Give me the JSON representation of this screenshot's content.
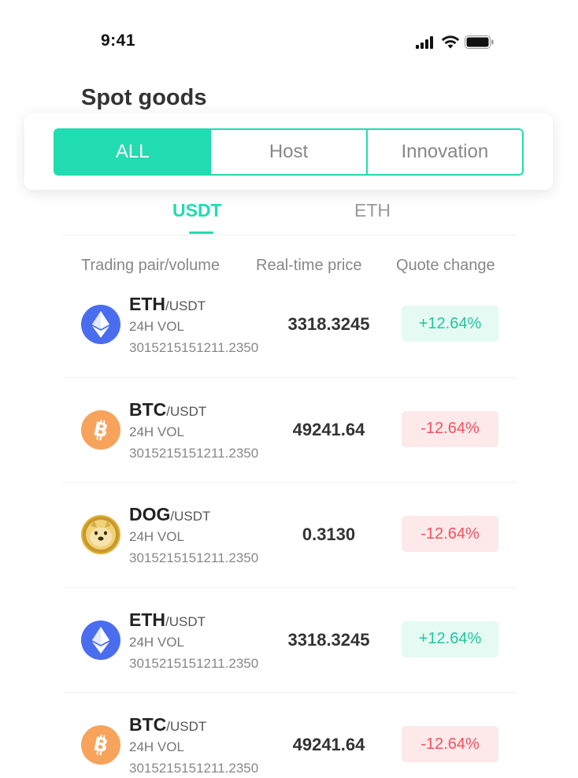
{
  "status_bar": {
    "time": "9:41"
  },
  "page": {
    "title": "Spot goods"
  },
  "segments": [
    {
      "label": "ALL",
      "active": true
    },
    {
      "label": "Host",
      "active": false
    },
    {
      "label": "Innovation",
      "active": false
    }
  ],
  "subtabs": [
    {
      "label": "USDT",
      "active": true
    },
    {
      "label": "ETH",
      "active": false
    }
  ],
  "columns": {
    "pair": "Trading pair/volume",
    "price": "Real-time price",
    "change": "Quote change"
  },
  "rows": [
    {
      "base": "ETH",
      "quote": "/USDT",
      "vol_label": "24H VOL",
      "vol": "3015215151211.2350",
      "price": "3318.3245",
      "change": "+12.64%",
      "direction": "up",
      "icon": "ethereum-icon"
    },
    {
      "base": "BTC",
      "quote": "/USDT",
      "vol_label": "24H VOL",
      "vol": "3015215151211.2350",
      "price": "49241.64",
      "change": "-12.64%",
      "direction": "down",
      "icon": "bitcoin-icon"
    },
    {
      "base": "DOG",
      "quote": "/USDT",
      "vol_label": "24H VOL",
      "vol": "3015215151211.2350",
      "price": "0.3130",
      "change": "-12.64%",
      "direction": "down",
      "icon": "doge-icon"
    },
    {
      "base": "ETH",
      "quote": "/USDT",
      "vol_label": "24H VOL",
      "vol": "3015215151211.2350",
      "price": "3318.3245",
      "change": "+12.64%",
      "direction": "up",
      "icon": "ethereum-icon"
    },
    {
      "base": "BTC",
      "quote": "/USDT",
      "vol_label": "24H VOL",
      "vol": "3015215151211.2350",
      "price": "49241.64",
      "change": "-12.64%",
      "direction": "down",
      "icon": "bitcoin-icon"
    }
  ],
  "colors": {
    "accent": "#20dcb0",
    "up": "#1fc79d",
    "down": "#f0525e",
    "eth": "#4a6df0",
    "btc": "#f7a35c",
    "doge": "#e3b53b"
  }
}
